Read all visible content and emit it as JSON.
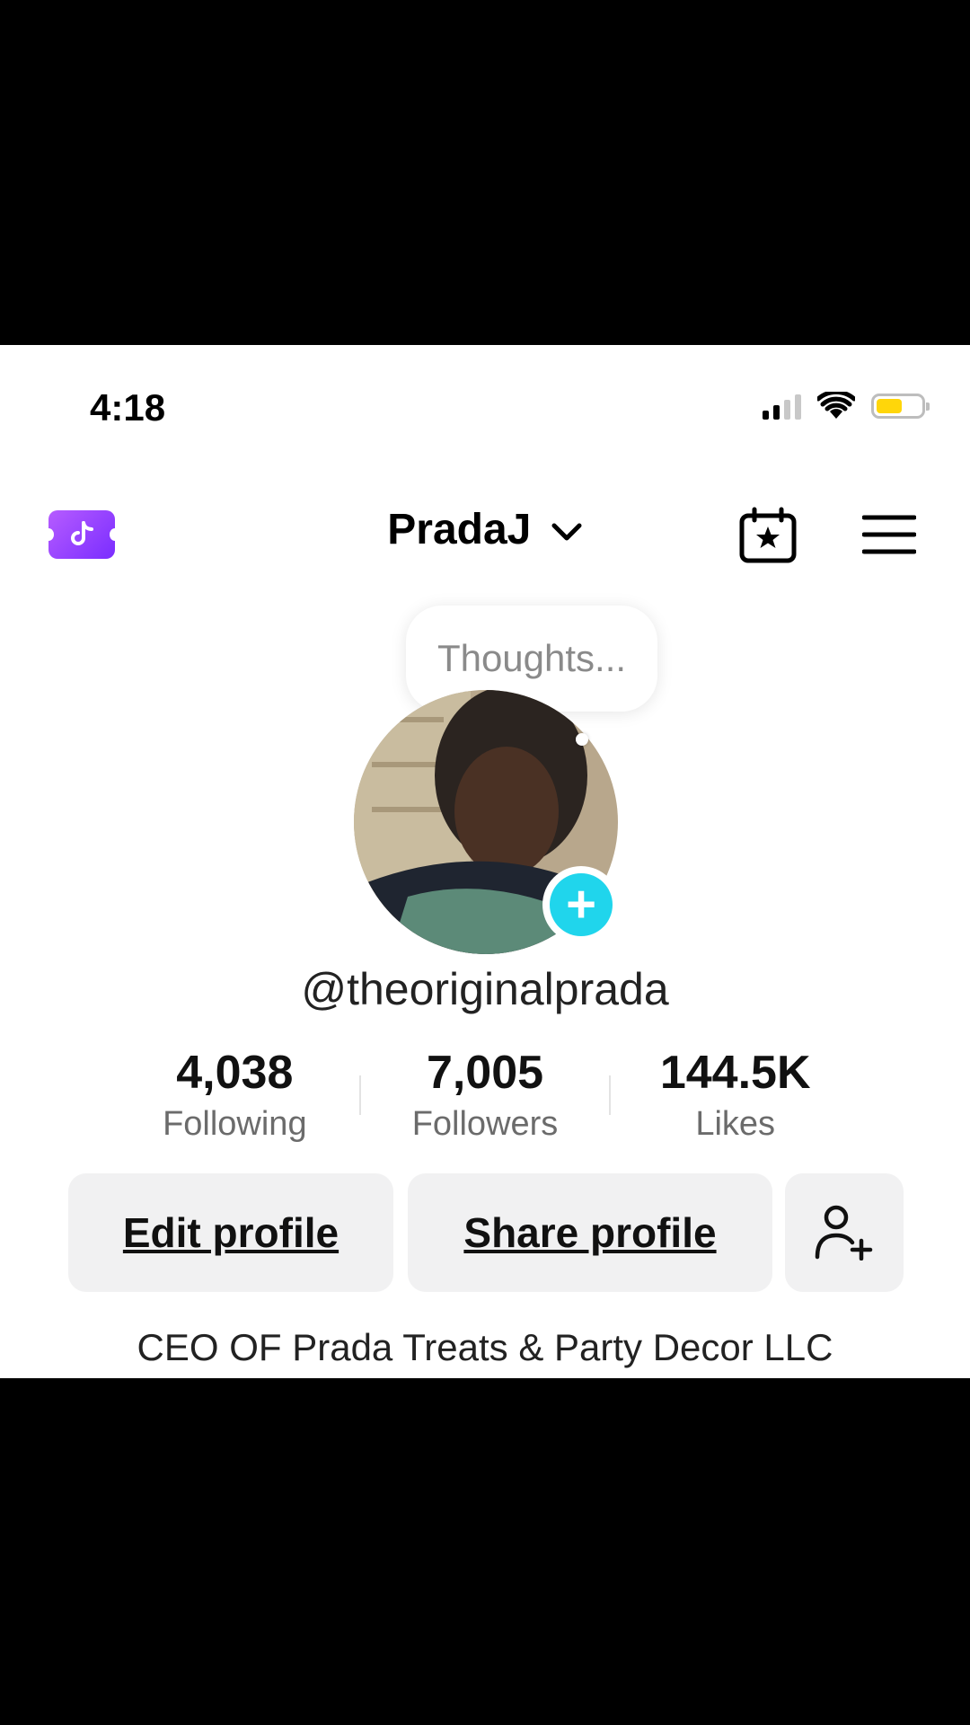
{
  "status_bar": {
    "time": "4:18"
  },
  "nav": {
    "title": "PradaJ"
  },
  "thought_bubble": {
    "text": "Thoughts..."
  },
  "profile": {
    "handle": "@theoriginalprada",
    "stats": [
      {
        "value": "4,038",
        "label": "Following"
      },
      {
        "value": "7,005",
        "label": "Followers"
      },
      {
        "value": "144.5K",
        "label": "Likes"
      }
    ],
    "buttons": {
      "edit": "Edit profile",
      "share": "Share profile"
    },
    "bio": "CEO OF Prada Treats & Party Decor LLC"
  },
  "colors": {
    "accent": "#20d5ec",
    "battery": "#ffd60a",
    "promo": "#8a3cff"
  },
  "icons": [
    "signal-icon",
    "wifi-icon",
    "battery-icon",
    "promo-ticket-icon",
    "chevron-down-icon",
    "calendar-star-icon",
    "menu-icon",
    "add-icon",
    "add-friend-icon"
  ]
}
